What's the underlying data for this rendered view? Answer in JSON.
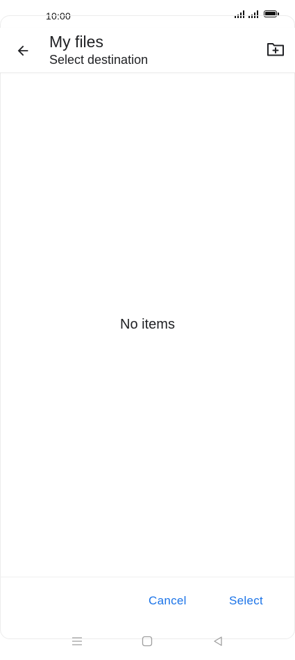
{
  "status_bar": {
    "time": "10:00"
  },
  "toolbar": {
    "title": "My files",
    "subtitle": "Select destination",
    "back_icon": "arrow-back-icon",
    "new_folder_icon": "create-new-folder-icon"
  },
  "content": {
    "empty_message": "No items"
  },
  "actions": {
    "cancel_label": "Cancel",
    "select_label": "Select"
  },
  "nav_bar": {
    "icons": [
      "menu-icon",
      "home-square-icon",
      "back-triangle-icon"
    ]
  },
  "colors": {
    "accent": "#1a73e8",
    "text": "#202124",
    "background": "#ffffff"
  }
}
